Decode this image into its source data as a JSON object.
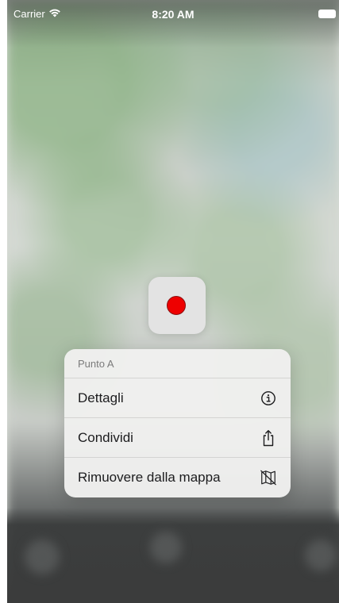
{
  "status_bar": {
    "carrier": "Carrier",
    "time": "8:20 AM"
  },
  "pin": {
    "color": "#ee0000"
  },
  "context_menu": {
    "title": "Punto A",
    "items": [
      {
        "label": "Dettagli",
        "icon": "info-circle-icon"
      },
      {
        "label": "Condividi",
        "icon": "share-icon"
      },
      {
        "label": "Rimuovere dalla mappa",
        "icon": "map-slash-icon"
      }
    ]
  }
}
